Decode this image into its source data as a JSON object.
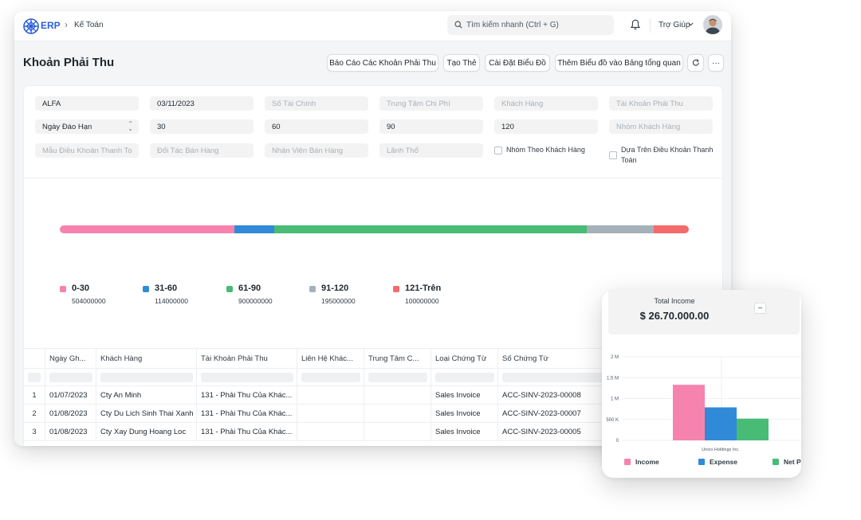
{
  "app": {
    "logo_text": "ERP",
    "breadcrumb": "Kế Toán"
  },
  "navbar": {
    "search_placeholder": "Tìm kiếm nhanh (Ctrl + G)",
    "help_label": "Trợ Giúp"
  },
  "page": {
    "title": "Khoản Phải Thu"
  },
  "toolbar": {
    "report_button": "Báo Cáo Các Khoản Phải Thu",
    "create_button": "Tạo Thẻ",
    "chart_settings_button": "Cài Đặt Biểu Đồ",
    "add_to_dashboard_button": "Thêm Biểu đồ vào Bảng tổng quan",
    "more_label": "···"
  },
  "filters": {
    "company": "ALFA",
    "date": "03/11/2023",
    "finance_book_ph": "Sổ Tài Chính",
    "cost_center_ph": "Trung Tâm Chi Phí",
    "customer_ph": "Khách Hàng",
    "receivable_account_ph": "Tài Khoản Phải Thu",
    "ageing_based_on": "Ngày Đáo Hạn",
    "range1": "30",
    "range2": "60",
    "range3": "90",
    "range4": "120",
    "customer_group_ph": "Nhóm Khách Hàng",
    "payment_terms_template_ph": "Mẫu Điều Khoản Thanh To",
    "sales_partner_ph": "Đối Tác Bán Hàng",
    "sales_person_ph": "Nhân Viên Bán Hàng",
    "territory_ph": "Lãnh Thổ",
    "group_by_customer_label": "Nhóm Theo Khách Hàng",
    "based_on_payment_terms_label": "Dựa Trên Điều Khoản Thanh Toán"
  },
  "ageing": {
    "segments": [
      {
        "name": "0-30",
        "value": "504000000",
        "color": "#f683ae"
      },
      {
        "name": "31-60",
        "value": "114000000",
        "color": "#318ad8"
      },
      {
        "name": "61-90",
        "value": "900000000",
        "color": "#48bb74"
      },
      {
        "name": "91-120",
        "value": "195000000",
        "color": "#a6b1b9"
      },
      {
        "name": "121-Trên",
        "value": "100000000",
        "color": "#f56b6b"
      }
    ]
  },
  "table": {
    "columns": [
      "Ngày Gh...",
      "Khách Hàng",
      "Tài Khoản Phải Thu",
      "Liên Hệ Khác...",
      "Trung Tâm C...",
      "Loại Chứng Từ",
      "Số Chứng Từ"
    ],
    "rows": [
      {
        "num": "1",
        "date": "01/07/2023",
        "customer": "Cty An Minh",
        "account": "131 - Phải Thu Của Khác...",
        "contact": "",
        "cost_center": "",
        "voucher_type": "Sales Invoice",
        "voucher_no": "ACC-SINV-2023-00008"
      },
      {
        "num": "2",
        "date": "01/08/2023",
        "customer": "Cty Du Lich Sinh Thai Xanh",
        "account": "131 - Phải Thu Của Khác...",
        "contact": "",
        "cost_center": "",
        "voucher_type": "Sales Invoice",
        "voucher_no": "ACC-SINV-2023-00007"
      },
      {
        "num": "3",
        "date": "01/08/2023",
        "customer": "Cty Xay Dung Hoang Loc",
        "account": "131 - Phải Thu Của Khác...",
        "contact": "",
        "cost_center": "",
        "voucher_type": "Sales Invoice",
        "voucher_no": "ACC-SINV-2023-00005"
      }
    ]
  },
  "income_card": {
    "title": "Total Income",
    "amount": "$ 26.70.000.00",
    "collapse_label": "–"
  },
  "chart_data": {
    "type": "bar",
    "categories": [
      "Unico Holdings Inc."
    ],
    "series": [
      {
        "name": "Income",
        "values": [
          1330000
        ],
        "color": "#f683ae"
      },
      {
        "name": "Expense",
        "values": [
          790000
        ],
        "color": "#318ad8"
      },
      {
        "name": "Net P",
        "values": [
          520000
        ],
        "color": "#48bb74"
      }
    ],
    "yticks": [
      "0",
      "500 K",
      "1 M",
      "1.5 M",
      "2 M"
    ],
    "ylim": [
      0,
      2000000
    ]
  }
}
